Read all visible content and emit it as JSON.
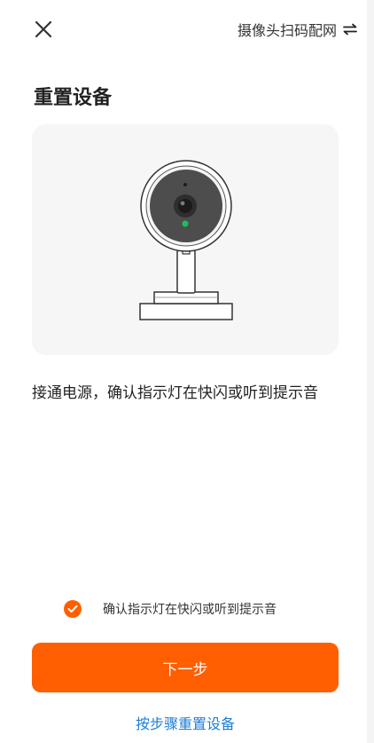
{
  "header": {
    "close_icon": "close-icon",
    "mode_label": "摄像头扫码配网",
    "mode_icon": "switch-arrows-icon"
  },
  "page": {
    "title": "重置设备",
    "instruction": "接通电源，确认指示灯在快闪或听到提示音"
  },
  "illustration": {
    "icon": "camera-illustration"
  },
  "confirm": {
    "checked": true,
    "label": "确认指示灯在快闪或听到提示音"
  },
  "actions": {
    "next_label": "下一步",
    "step_link_label": "按步骤重置设备"
  },
  "colors": {
    "accent": "#ff5f00",
    "link": "#1c7ed6",
    "card_background": "#f6f6f6",
    "indicator_light": "#16c45a"
  }
}
